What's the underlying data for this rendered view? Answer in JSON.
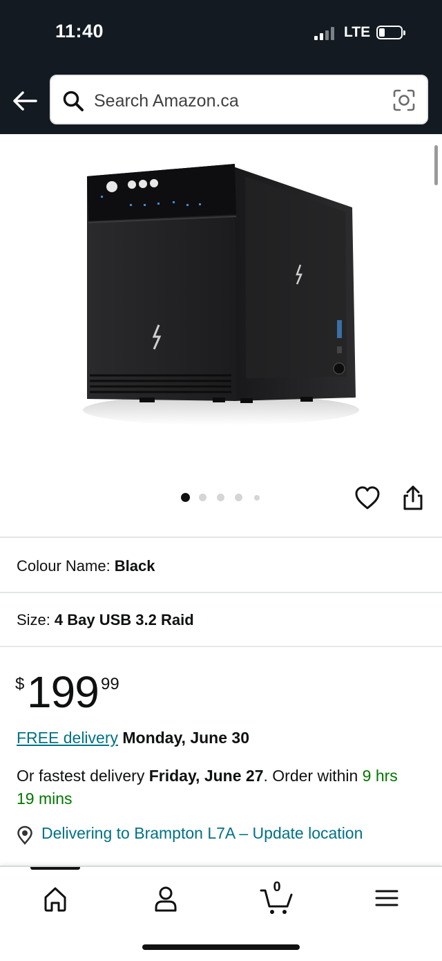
{
  "status_bar": {
    "time": "11:40",
    "network": "LTE"
  },
  "search": {
    "placeholder": "Search Amazon.ca"
  },
  "product": {
    "image_alt": "4 Bay USB 3.2 RAID hard drive enclosure, black",
    "image_count": 5,
    "active_image": 1
  },
  "variations": {
    "colour_label": "Colour Name:",
    "colour_value": "Black",
    "size_label": "Size:",
    "size_value": "4 Bay USB 3.2 Raid"
  },
  "price": {
    "currency": "$",
    "whole": "199",
    "fraction": "99"
  },
  "delivery": {
    "free_link": "FREE delivery",
    "free_date": "Monday, June 30",
    "fastest_prefix": "Or fastest delivery",
    "fastest_date": "Friday, June 27",
    "order_within_prefix": ". Order within",
    "order_within": "9 hrs 19 mins"
  },
  "location": {
    "text": "Delivering to Brampton L7A – Update location"
  },
  "bottom_nav": {
    "items": [
      "home",
      "account",
      "cart",
      "menu"
    ],
    "cart_count": "0"
  },
  "colors": {
    "header_bg": "#131a22",
    "link": "#007185",
    "green": "#007600"
  }
}
